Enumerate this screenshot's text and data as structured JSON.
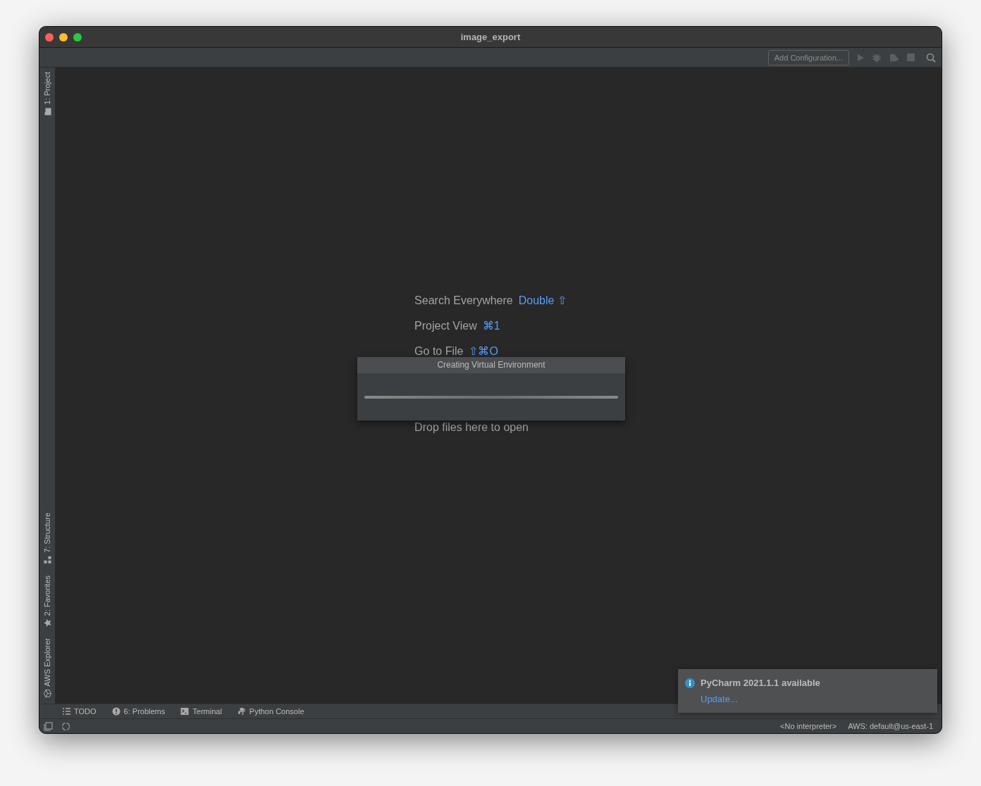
{
  "window": {
    "title": "image_export"
  },
  "toolbar": {
    "config_button": "Add Configuration..."
  },
  "left_strip": {
    "top": [
      {
        "label": "1: Project",
        "kind": "project"
      }
    ],
    "bottom": [
      {
        "label": "7: Structure",
        "kind": "structure"
      },
      {
        "label": "2: Favorites",
        "kind": "favorites"
      },
      {
        "label": "AWS Explorer",
        "kind": "aws"
      }
    ]
  },
  "hints": [
    {
      "label": "Search Everywhere",
      "shortcut": "Double ⇧"
    },
    {
      "label": "Project View",
      "shortcut": "⌘1"
    },
    {
      "label": "Go to File",
      "shortcut": "⇧⌘O"
    },
    {
      "label": "Drop files here to open"
    }
  ],
  "progress_dialog": {
    "title": "Creating Virtual Environment",
    "level": 1
  },
  "bottom_tabs": [
    {
      "label": "TODO",
      "kind": "todo"
    },
    {
      "label": "6: Problems",
      "kind": "problems"
    },
    {
      "label": "Terminal",
      "kind": "terminal"
    },
    {
      "label": "Python Console",
      "kind": "python"
    }
  ],
  "notification": {
    "title": "PyCharm 2021.1.1 available",
    "link": "Update..."
  },
  "status_bar": [
    "<No interpreter>",
    "AWS: default@us-east-1"
  ]
}
